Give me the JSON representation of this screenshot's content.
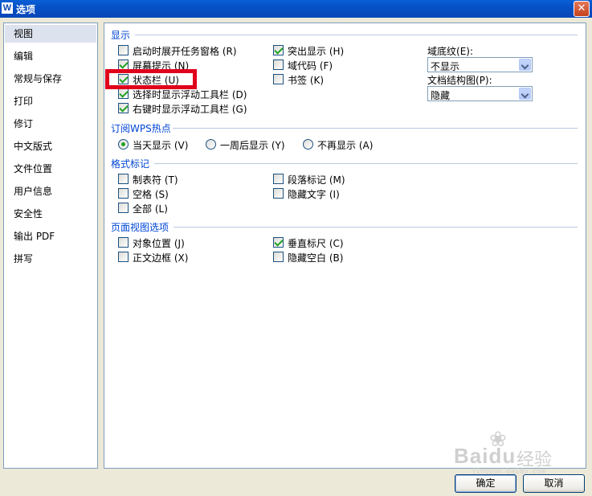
{
  "window": {
    "icon_letter": "W",
    "title": "选项",
    "close_glyph": "✕"
  },
  "sidebar": {
    "items": [
      {
        "label": "视图",
        "selected": true
      },
      {
        "label": "编辑"
      },
      {
        "label": "常规与保存"
      },
      {
        "label": "打印"
      },
      {
        "label": "修订"
      },
      {
        "label": "中文版式"
      },
      {
        "label": "文件位置"
      },
      {
        "label": "用户信息"
      },
      {
        "label": "安全性"
      },
      {
        "label": "输出 PDF"
      },
      {
        "label": "拼写"
      }
    ]
  },
  "display": {
    "title": "显示",
    "options": [
      {
        "label": "启动时展开任务窗格",
        "key": "(R)",
        "checked": false
      },
      {
        "label": "屏幕提示",
        "key": "(N)",
        "checked": true
      },
      {
        "label": "状态栏",
        "key": "(U)",
        "checked": true
      },
      {
        "label": "选择时显示浮动工具栏",
        "key": "(D)",
        "checked": true
      },
      {
        "label": "右键时显示浮动工具栏",
        "key": "(G)",
        "checked": true
      },
      {
        "label": "突出显示",
        "key": "(H)",
        "checked": true
      },
      {
        "label": "域代码",
        "key": "(F)",
        "checked": false
      },
      {
        "label": "书签",
        "key": "(K)",
        "checked": false
      }
    ],
    "field_shading": {
      "label": "域底纹",
      "key": "(E)",
      "suffix": ":",
      "value": "不显示"
    },
    "doc_map": {
      "label": "文档结构图",
      "key": "(P)",
      "suffix": ":",
      "value": "隐藏"
    }
  },
  "wps_hot": {
    "title": "订阅WPS热点",
    "options": [
      {
        "label": "当天显示",
        "key": "(V)",
        "checked": true
      },
      {
        "label": "一周后显示",
        "key": "(Y)",
        "checked": false
      },
      {
        "label": "不再显示",
        "key": "(A)",
        "checked": false
      }
    ]
  },
  "formatting_marks": {
    "title": "格式标记",
    "options": [
      {
        "label": "制表符",
        "key": "(T)",
        "checked": false
      },
      {
        "label": "空格",
        "key": "(S)",
        "checked": false
      },
      {
        "label": "全部",
        "key": "(L)",
        "checked": false
      },
      {
        "label": "段落标记",
        "key": "(M)",
        "checked": false
      },
      {
        "label": "隐藏文字",
        "key": "(I)",
        "checked": false
      }
    ]
  },
  "page_view": {
    "title": "页面视图选项",
    "options": [
      {
        "label": "对象位置",
        "key": "(J)",
        "checked": false
      },
      {
        "label": "正文边框",
        "key": "(X)",
        "checked": false
      },
      {
        "label": "垂直标尺",
        "key": "(C)",
        "checked": true
      },
      {
        "label": "隐藏空白",
        "key": "(B)",
        "checked": false
      }
    ]
  },
  "buttons": {
    "ok": "确定",
    "cancel": "取消"
  },
  "watermark": {
    "text": "Baidu",
    "suffix": "经验",
    "url": "jingyan.baidu.com"
  },
  "colors": {
    "highlight": "#e0001b",
    "check": "#21a121",
    "section_title": "#0046d5"
  }
}
